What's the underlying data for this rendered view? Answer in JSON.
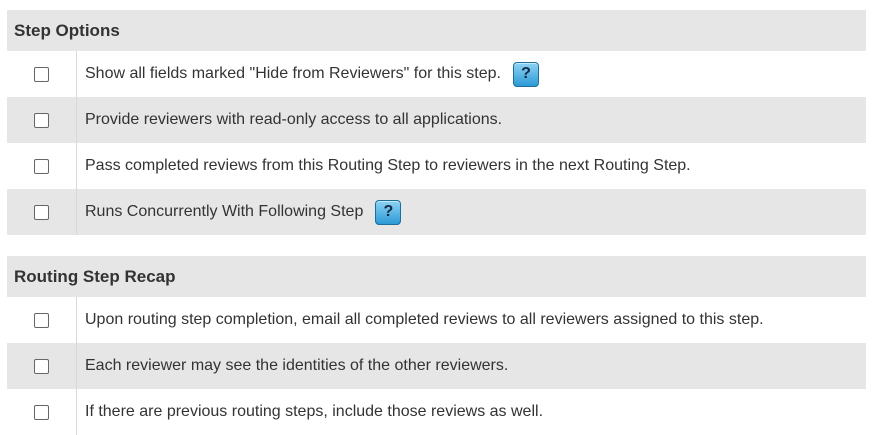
{
  "step_options": {
    "title": "Step Options",
    "items": [
      {
        "label": "Show all fields marked \"Hide from Reviewers\" for this step.",
        "help": "?"
      },
      {
        "label": "Provide reviewers with read-only access to all applications."
      },
      {
        "label": "Pass completed reviews from this Routing Step to reviewers in the next Routing Step."
      },
      {
        "label": "Runs Concurrently With Following Step",
        "help": "?"
      }
    ]
  },
  "routing_step_recap": {
    "title": "Routing Step Recap",
    "items": [
      {
        "label": "Upon routing step completion, email all completed reviews to all reviewers assigned to this step."
      },
      {
        "label": "Each reviewer may see the identities of the other reviewers."
      },
      {
        "label": "If there are previous routing steps, include those reviews as well."
      }
    ]
  },
  "colors": {
    "header_bg": "#e6e6e6",
    "alt_row_bg": "#e6e6e6",
    "help_button": "#2c9ad6"
  },
  "icons": {
    "help": "question-mark-icon"
  }
}
